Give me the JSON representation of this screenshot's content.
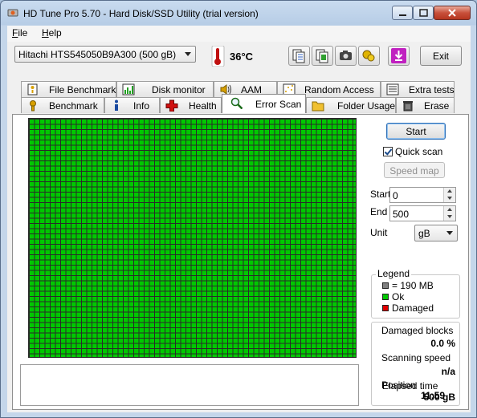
{
  "window": {
    "title": "HD Tune Pro 5.70 - Hard Disk/SSD Utility (trial version)"
  },
  "menu": [
    "File",
    "Help"
  ],
  "toolbar": {
    "drive": "Hitachi HTS545050B9A300 (500 gB)",
    "temperature": "36°C",
    "exit_label": "Exit",
    "icons": [
      "copy-text-icon",
      "copy-screenshot-icon",
      "camera-icon",
      "options-icon",
      "download-icon"
    ]
  },
  "tabs_row1": [
    "File Benchmark",
    "Disk monitor",
    "AAM",
    "Random Access",
    "Extra tests"
  ],
  "tabs_row2": [
    "Benchmark",
    "Info",
    "Health",
    "Error Scan",
    "Folder Usage",
    "Erase"
  ],
  "active_tab": "Error Scan",
  "error_scan": {
    "start_button": "Start",
    "quick_scan_label": "Quick scan",
    "quick_scan_checked": true,
    "speed_map_button": "Speed map",
    "start_label": "Start",
    "start_value": "0",
    "end_label": "End",
    "end_value": "500",
    "unit_label": "Unit",
    "unit_value": "gB",
    "legend": {
      "title": "Legend",
      "block_size": "= 190 MB",
      "ok": "Ok",
      "damaged": "Damaged",
      "colors": {
        "block": "#808080",
        "ok": "#00c800",
        "damaged": "#e00000"
      }
    },
    "stats": {
      "damaged_blocks_label": "Damaged blocks",
      "damaged_blocks_value": "0.0 %",
      "scanning_speed_label": "Scanning speed",
      "scanning_speed_value": "n/a",
      "position_label": "Position",
      "position_value": "500 gB",
      "elapsed_label": "Elapsed time",
      "elapsed_value": "11:59"
    }
  }
}
